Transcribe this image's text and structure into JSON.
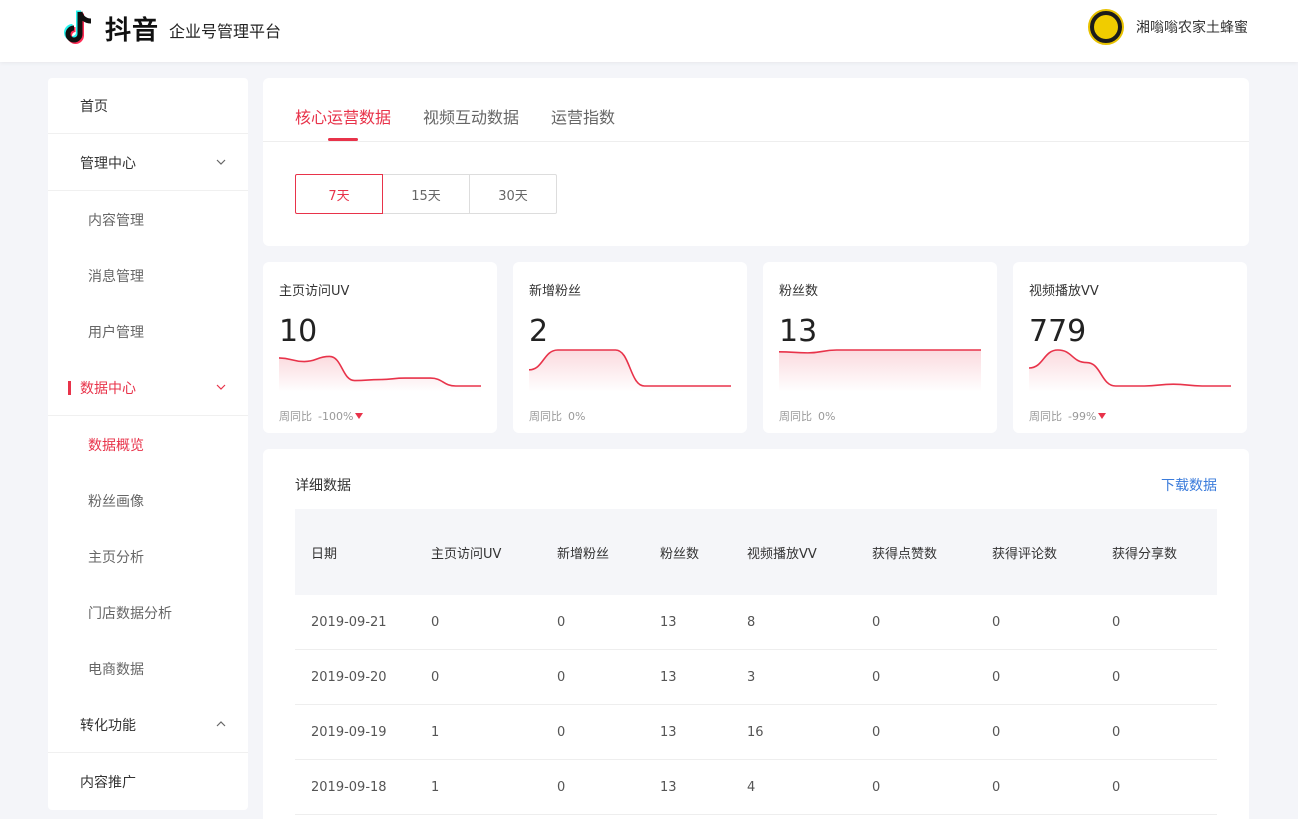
{
  "header": {
    "brand": "抖音",
    "subtitle": "企业号管理平台",
    "user_name": "湘嗡嗡农家土蜂蜜"
  },
  "sidebar": {
    "items": [
      {
        "label": "首页"
      },
      {
        "label": "管理中心"
      },
      {
        "label": "内容管理"
      },
      {
        "label": "消息管理"
      },
      {
        "label": "用户管理"
      },
      {
        "label": "数据中心"
      },
      {
        "label": "数据概览"
      },
      {
        "label": "粉丝画像"
      },
      {
        "label": "主页分析"
      },
      {
        "label": "门店数据分析"
      },
      {
        "label": "电商数据"
      },
      {
        "label": "转化功能"
      },
      {
        "label": "内容推广"
      }
    ]
  },
  "tabs": [
    {
      "label": "核心运营数据"
    },
    {
      "label": "视频互动数据"
    },
    {
      "label": "运营指数"
    }
  ],
  "ranges": [
    {
      "label": "7天"
    },
    {
      "label": "15天"
    },
    {
      "label": "30天"
    }
  ],
  "metrics": [
    {
      "title": "主页访问UV",
      "value": "10",
      "foot_label": "周同比",
      "foot_pct": "-100%",
      "trend": [
        0.22,
        0.32,
        0.18,
        0.85,
        0.82,
        0.78,
        0.78,
        1.0,
        1.0
      ]
    },
    {
      "title": "新增粉丝",
      "value": "2",
      "foot_label": "周同比",
      "foot_pct": "0%",
      "trend": [
        0.55,
        0.0,
        0.0,
        0.0,
        1.0,
        1.0,
        1.0,
        1.0
      ]
    },
    {
      "title": "粉丝数",
      "value": "13",
      "foot_label": "周同比",
      "foot_pct": "0%",
      "trend": [
        0.05,
        0.08,
        0.0,
        0.0,
        0.0,
        0.0,
        0.0,
        0.0
      ]
    },
    {
      "title": "视频播放VV",
      "value": "779",
      "foot_label": "周同比",
      "foot_pct": "-99%",
      "trend": [
        0.5,
        0.0,
        0.35,
        1.0,
        1.0,
        0.95,
        1.0,
        1.0
      ]
    }
  ],
  "detail": {
    "title": "详细数据",
    "download_label": "下载数据",
    "columns": [
      "日期",
      "主页访问UV",
      "新增粉丝",
      "粉丝数",
      "视频播放VV",
      "获得点赞数",
      "获得评论数",
      "获得分享数"
    ],
    "rows": [
      [
        "2019-09-21",
        "0",
        "0",
        "13",
        "8",
        "0",
        "0",
        "0"
      ],
      [
        "2019-09-20",
        "0",
        "0",
        "13",
        "3",
        "0",
        "0",
        "0"
      ],
      [
        "2019-09-19",
        "1",
        "0",
        "13",
        "16",
        "0",
        "0",
        "0"
      ],
      [
        "2019-09-18",
        "1",
        "0",
        "13",
        "4",
        "0",
        "0",
        "0"
      ]
    ]
  },
  "colors": {
    "accent": "#e8334a",
    "link": "#3a7bdb"
  }
}
